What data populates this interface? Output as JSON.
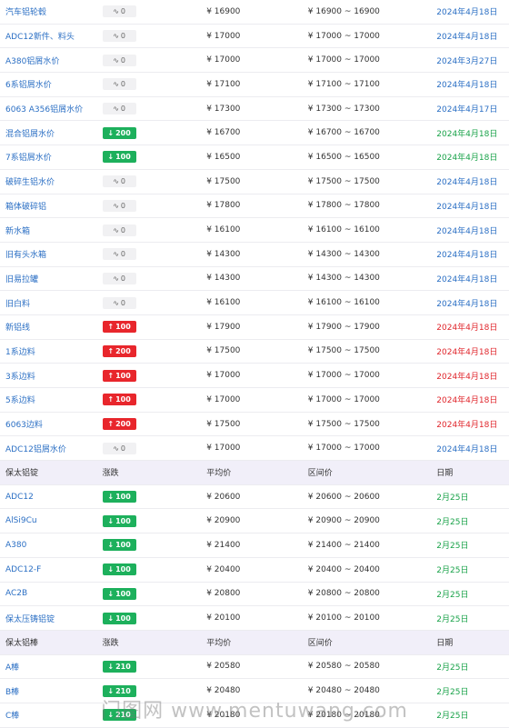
{
  "colors": {
    "header_bg": "#f1eff9",
    "up_badge": "#e8262c",
    "down_badge": "#1db05c",
    "name_blue": "#2b6fc4"
  },
  "rows1": [
    {
      "name": "汽车铝轮毂",
      "change": "0",
      "dir": "flat",
      "avg": "¥ 16900",
      "range": "¥ 16900 ~ 16900",
      "date": "2024年4月18日",
      "dc": "blue"
    },
    {
      "name": "ADC12新件、料头",
      "change": "0",
      "dir": "flat",
      "avg": "¥ 17000",
      "range": "¥ 17000 ~ 17000",
      "date": "2024年4月18日",
      "dc": "blue"
    },
    {
      "name": "A380铝屑水价",
      "change": "0",
      "dir": "flat",
      "avg": "¥ 17000",
      "range": "¥ 17000 ~ 17000",
      "date": "2024年3月27日",
      "dc": "blue"
    },
    {
      "name": "6系铝屑水价",
      "change": "0",
      "dir": "flat",
      "avg": "¥ 17100",
      "range": "¥ 17100 ~ 17100",
      "date": "2024年4月18日",
      "dc": "blue"
    },
    {
      "name": "6063 A356铝屑水价",
      "change": "0",
      "dir": "flat",
      "avg": "¥ 17300",
      "range": "¥ 17300 ~ 17300",
      "date": "2024年4月17日",
      "dc": "blue"
    },
    {
      "name": "混合铝屑水价",
      "change": "200",
      "dir": "down",
      "avg": "¥ 16700",
      "range": "¥ 16700 ~ 16700",
      "date": "2024年4月18日",
      "dc": "green"
    },
    {
      "name": "7系铝屑水价",
      "change": "100",
      "dir": "down",
      "avg": "¥ 16500",
      "range": "¥ 16500 ~ 16500",
      "date": "2024年4月18日",
      "dc": "green"
    },
    {
      "name": "破碎生铝水价",
      "change": "0",
      "dir": "flat",
      "avg": "¥ 17500",
      "range": "¥ 17500 ~ 17500",
      "date": "2024年4月18日",
      "dc": "blue"
    },
    {
      "name": "箱体破碎铝",
      "change": "0",
      "dir": "flat",
      "avg": "¥ 17800",
      "range": "¥ 17800 ~ 17800",
      "date": "2024年4月18日",
      "dc": "blue"
    },
    {
      "name": "新水箱",
      "change": "0",
      "dir": "flat",
      "avg": "¥ 16100",
      "range": "¥ 16100 ~ 16100",
      "date": "2024年4月18日",
      "dc": "blue"
    },
    {
      "name": "旧有头水箱",
      "change": "0",
      "dir": "flat",
      "avg": "¥ 14300",
      "range": "¥ 14300 ~ 14300",
      "date": "2024年4月18日",
      "dc": "blue"
    },
    {
      "name": "旧易拉罐",
      "change": "0",
      "dir": "flat",
      "avg": "¥ 14300",
      "range": "¥ 14300 ~ 14300",
      "date": "2024年4月18日",
      "dc": "blue"
    },
    {
      "name": "旧白料",
      "change": "0",
      "dir": "flat",
      "avg": "¥ 16100",
      "range": "¥ 16100 ~ 16100",
      "date": "2024年4月18日",
      "dc": "blue"
    },
    {
      "name": "新铝线",
      "change": "100",
      "dir": "up",
      "avg": "¥ 17900",
      "range": "¥ 17900 ~ 17900",
      "date": "2024年4月18日",
      "dc": "red"
    },
    {
      "name": "1系边料",
      "change": "200",
      "dir": "up",
      "avg": "¥ 17500",
      "range": "¥ 17500 ~ 17500",
      "date": "2024年4月18日",
      "dc": "red"
    },
    {
      "name": "3系边料",
      "change": "100",
      "dir": "up",
      "avg": "¥ 17000",
      "range": "¥ 17000 ~ 17000",
      "date": "2024年4月18日",
      "dc": "red"
    },
    {
      "name": "5系边料",
      "change": "100",
      "dir": "up",
      "avg": "¥ 17000",
      "range": "¥ 17000 ~ 17000",
      "date": "2024年4月18日",
      "dc": "red"
    },
    {
      "name": "6063边料",
      "change": "200",
      "dir": "up",
      "avg": "¥ 17500",
      "range": "¥ 17500 ~ 17500",
      "date": "2024年4月18日",
      "dc": "red"
    },
    {
      "name": "ADC12铝屑水价",
      "change": "0",
      "dir": "flat",
      "avg": "¥ 17000",
      "range": "¥ 17000 ~ 17000",
      "date": "2024年4月18日",
      "dc": "blue"
    }
  ],
  "section2": {
    "header": {
      "name": "保太铝锭",
      "change": "涨跌",
      "avg": "平均价",
      "range": "区间价",
      "date": "日期"
    },
    "rows": [
      {
        "name": "ADC12",
        "change": "100",
        "dir": "down",
        "avg": "¥ 20600",
        "range": "¥ 20600 ~ 20600",
        "date": "2月25日",
        "dc": "green"
      },
      {
        "name": "AlSi9Cu",
        "change": "100",
        "dir": "down",
        "avg": "¥ 20900",
        "range": "¥ 20900 ~ 20900",
        "date": "2月25日",
        "dc": "green"
      },
      {
        "name": "A380",
        "change": "100",
        "dir": "down",
        "avg": "¥ 21400",
        "range": "¥ 21400 ~ 21400",
        "date": "2月25日",
        "dc": "green"
      },
      {
        "name": "ADC12-F",
        "change": "100",
        "dir": "down",
        "avg": "¥ 20400",
        "range": "¥ 20400 ~ 20400",
        "date": "2月25日",
        "dc": "green"
      },
      {
        "name": "AC2B",
        "change": "100",
        "dir": "down",
        "avg": "¥ 20800",
        "range": "¥ 20800 ~ 20800",
        "date": "2月25日",
        "dc": "green"
      },
      {
        "name": "保太压铸铝锭",
        "change": "100",
        "dir": "down",
        "avg": "¥ 20100",
        "range": "¥ 20100 ~ 20100",
        "date": "2月25日",
        "dc": "green"
      }
    ]
  },
  "section3": {
    "header": {
      "name": "保太铝棒",
      "change": "涨跌",
      "avg": "平均价",
      "range": "区间价",
      "date": "日期"
    },
    "rows": [
      {
        "name": "A棒",
        "change": "210",
        "dir": "down",
        "avg": "¥ 20580",
        "range": "¥ 20580 ~ 20580",
        "date": "2月25日",
        "dc": "green"
      },
      {
        "name": "B棒",
        "change": "210",
        "dir": "down",
        "avg": "¥ 20480",
        "range": "¥ 20480 ~ 20480",
        "date": "2月25日",
        "dc": "green"
      },
      {
        "name": "C棒",
        "change": "210",
        "dir": "down",
        "avg": "¥ 20180",
        "range": "¥ 20180 ~ 20180",
        "date": "2月25日",
        "dc": "green"
      }
    ]
  },
  "watermark": "门图网 www.mentuwang.com",
  "icons": {
    "flat": "wave-icon",
    "up": "up-arrow-icon",
    "down": "down-arrow-icon"
  }
}
